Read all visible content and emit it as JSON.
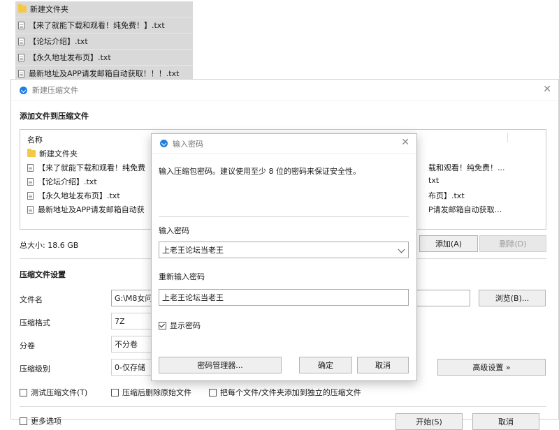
{
  "explorer": {
    "items": [
      {
        "type": "folder",
        "name": "新建文件夹"
      },
      {
        "type": "file",
        "name": "【来了就能下载和观看！纯免费！】.txt"
      },
      {
        "type": "file",
        "name": "【论坛介绍】.txt"
      },
      {
        "type": "file",
        "name": "【永久地址发布页】.txt"
      },
      {
        "type": "file",
        "name": "最新地址及APP请发邮箱自动获取！！！.txt"
      }
    ]
  },
  "main_window": {
    "title": "新建压缩文件",
    "section_add": "添加文件到压缩文件",
    "file_list": {
      "header": "名称",
      "left_items": [
        {
          "type": "folder",
          "name": "新建文件夹"
        },
        {
          "type": "file",
          "name": "【来了就能下载和观看！纯免费"
        },
        {
          "type": "file",
          "name": "【论坛介绍】.txt"
        },
        {
          "type": "file",
          "name": "【永久地址发布页】.txt"
        },
        {
          "type": "file",
          "name": "最新地址及APP请发邮箱自动获"
        }
      ],
      "right_items": [
        "载和观看！纯免费！...",
        "txt",
        "布页】.txt",
        "P请发邮箱自动获取..."
      ]
    },
    "total_size": "总大小: 18.6 GB",
    "add_button": "添加(A)",
    "delete_button": "删除(D)",
    "section_settings": "压缩文件设置",
    "filename_label": "文件名",
    "filename_value": "G:\\M8女问",
    "browse_button": "浏览(B)...",
    "format_label": "压缩格式",
    "format_value": "7Z",
    "split_label": "分卷",
    "split_value": "不分卷",
    "level_label": "压缩级别",
    "level_value": "0-仅存储",
    "advanced_button": "高级设置 »",
    "options": {
      "test": "测试压缩文件(T)",
      "delete_after": "压缩后删除原始文件",
      "separate": "把每个文件/文件夹添加到独立的压缩文件"
    },
    "more_options": "更多选项",
    "start_button": "开始(S)",
    "cancel_button": "取消"
  },
  "password_dialog": {
    "title": "输入密码",
    "hint": "输入压缩包密码。建议使用至少 8 位的密码来保证安全性。",
    "enter_label": "输入密码",
    "enter_value": "上老王论坛当老王",
    "reenter_label": "重新输入密码",
    "reenter_value": "上老王论坛当老王",
    "show_password": "显示密码",
    "show_password_checked": true,
    "manager_button": "密码管理器...",
    "ok_button": "确定",
    "cancel_button": "取消"
  },
  "colors": {
    "accent": "#1f7fe0",
    "folder": "#f3c84b",
    "selection": "#d9d9d9"
  }
}
